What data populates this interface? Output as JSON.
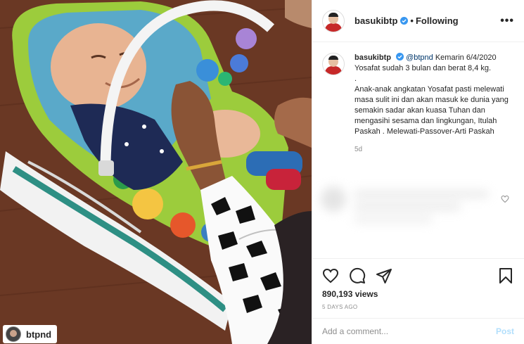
{
  "media": {
    "tag_username": "btpnd",
    "tag_icon": "avatar"
  },
  "header": {
    "username": "basukibtp",
    "separator": "•",
    "follow_state": "Following",
    "more_label": "•••"
  },
  "caption": {
    "username": "basukibtp",
    "mention": "@btpnd",
    "text_line1": " Kemarin 6/4/2020 Yosafat sudah 3 bulan dan berat 8,4 kg.",
    "text_dot": ".",
    "text_body": "Anak-anak angkatan Yosafat pasti melewati masa sulit ini dan akan masuk ke dunia yang semakin sadar akan kuasa Tuhan dan mengasihi sesama dan lingkungan, Itulah Paskah . Melewati-Passover-Arti Paskah",
    "time": "5d"
  },
  "actions": {
    "views": "890,193 views",
    "posted_ago": "5 DAYS AGO",
    "icons": [
      "heart-icon",
      "comment-icon",
      "share-icon",
      "bookmark-icon"
    ]
  },
  "composer": {
    "placeholder": "Add a comment...",
    "post_label": "Post"
  },
  "colors": {
    "verified_blue": "#3897f0",
    "link_blue": "#00376b",
    "post_disabled": "#b2dffc",
    "muted_gray": "#8e8e8e"
  }
}
